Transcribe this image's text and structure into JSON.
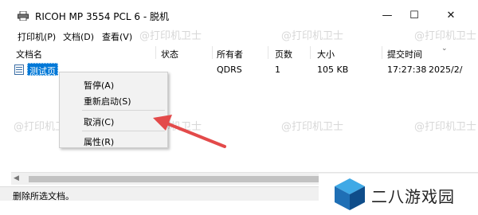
{
  "window": {
    "title": "RICOH MP 3554 PCL 6 - 脱机",
    "controls": {
      "minimize": "—",
      "maximize": "☐",
      "close": "✕"
    }
  },
  "menu": {
    "items": [
      "打印机(P)",
      "文档(D)",
      "查看(V)"
    ]
  },
  "list": {
    "columns": [
      "文档名",
      "状态",
      "所有者",
      "页数",
      "大小",
      "提交时间"
    ],
    "rows": [
      {
        "name": "测试页",
        "status": "",
        "owner": "QDRS",
        "pages": "1",
        "size": "105 KB",
        "time": "17:27:38",
        "date": "2025/2/"
      }
    ]
  },
  "context_menu": {
    "items": [
      "暂停(A)",
      "重新启动(S)",
      "取消(C)",
      "属性(R)"
    ]
  },
  "status_bar": {
    "text": "删除所选文档。"
  },
  "watermark": {
    "text": "@打印机卫士"
  },
  "logo": {
    "text": "二八游戏园"
  },
  "colors": {
    "selection": "#0078d7",
    "arrow": "#e34a4a"
  }
}
